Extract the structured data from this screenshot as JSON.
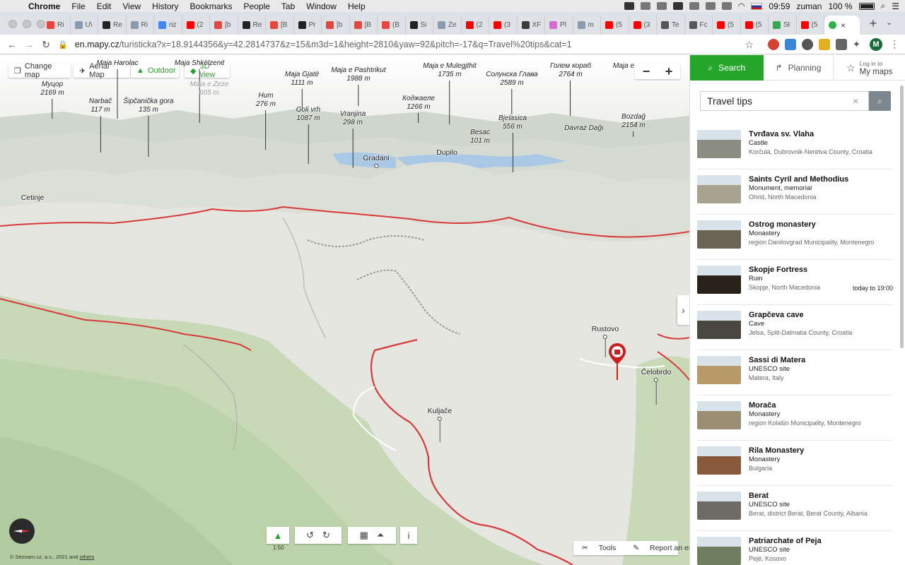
{
  "mac_menu": {
    "app": "Chrome",
    "items": [
      "File",
      "Edit",
      "View",
      "History",
      "Bookmarks",
      "People",
      "Tab",
      "Window",
      "Help"
    ],
    "time": "09:59",
    "user": "zuman",
    "battery": "100 %"
  },
  "browser": {
    "tabs": [
      {
        "label": "Ri",
        "color": "#e8453c"
      },
      {
        "label": "U\\",
        "color": "#8a9bb0"
      },
      {
        "label": "Re",
        "color": "#222222"
      },
      {
        "label": "Ri",
        "color": "#8a9bb0"
      },
      {
        "label": "riz",
        "color": "#4285f4"
      },
      {
        "label": "(2",
        "color": "#ff0000"
      },
      {
        "label": "[b",
        "color": "#e8453c"
      },
      {
        "label": "Re",
        "color": "#222222"
      },
      {
        "label": "[B",
        "color": "#e8453c"
      },
      {
        "label": "Pr",
        "color": "#222222"
      },
      {
        "label": "[b",
        "color": "#e8453c"
      },
      {
        "label": "[B",
        "color": "#e8453c"
      },
      {
        "label": "(B",
        "color": "#e8453c"
      },
      {
        "label": "Si",
        "color": "#222222"
      },
      {
        "label": "Ze",
        "color": "#8a9bb0"
      },
      {
        "label": "(2",
        "color": "#ff0000"
      },
      {
        "label": "(3",
        "color": "#ff0000"
      },
      {
        "label": "XF",
        "color": "#3a3a3a"
      },
      {
        "label": "Pl",
        "color": "#d86ad8"
      },
      {
        "label": "m",
        "color": "#8a9bb0"
      },
      {
        "label": "(5",
        "color": "#ff0000"
      },
      {
        "label": "(3",
        "color": "#ff0000"
      },
      {
        "label": "Te",
        "color": "#555555"
      },
      {
        "label": "Fc",
        "color": "#555555"
      },
      {
        "label": "(5",
        "color": "#ff0000"
      },
      {
        "label": "(5",
        "color": "#ff0000"
      },
      {
        "label": "Sł",
        "color": "#34a853"
      },
      {
        "label": "(5",
        "color": "#ff0000"
      }
    ],
    "url_host": "en.mapy.cz",
    "url_path": "/turisticka?x=18.9144356&y=42.2814737&z=15&m3d=1&height=2810&yaw=92&pitch=-17&q=Travel%20tips&cat=1",
    "profile_initial": "M"
  },
  "map": {
    "buttons": {
      "change_map": "Change map",
      "aerial_map": "Aerial Map",
      "outdoor": "Outdoor",
      "view3d": "3D view"
    },
    "zoom_out": "−",
    "zoom_in": "+",
    "peaks": [
      {
        "name": "Муцор",
        "elev": "2169 m"
      },
      {
        "name": "Maja Harolac",
        "elev": ""
      },
      {
        "name": "Narbač",
        "elev": "117 m"
      },
      {
        "name": "Šipčanička gora",
        "elev": "135 m"
      },
      {
        "name": "Maja Shkëlzenit",
        "elev": ""
      },
      {
        "name": "Maja e Zeze",
        "elev": "605 m"
      },
      {
        "name": "Hum",
        "elev": "276 m"
      },
      {
        "name": "Maja Gjatë",
        "elev": "1111 m"
      },
      {
        "name": "Goli vrh",
        "elev": "1087 m"
      },
      {
        "name": "Maja e Pashtrikut",
        "elev": "1988 m"
      },
      {
        "name": "Vranjina",
        "elev": "298 m"
      },
      {
        "name": "Коджаеле",
        "elev": "1266 m"
      },
      {
        "name": "Maja e Mulegjthit",
        "elev": "1735 m"
      },
      {
        "name": "Besac",
        "elev": "101 m"
      },
      {
        "name": "Солунска Глава",
        "elev": "2589 m"
      },
      {
        "name": "Bjelasica",
        "elev": "556 m"
      },
      {
        "name": "Голем кораб",
        "elev": "2764 m"
      },
      {
        "name": "Davraz Dağı",
        "elev": ""
      },
      {
        "name": "Maja e",
        "elev": ""
      },
      {
        "name": "Bozdağ",
        "elev": "2154 m"
      }
    ],
    "places": [
      {
        "name": "Gradani"
      },
      {
        "name": "Dupilo"
      },
      {
        "name": "Cetinje"
      },
      {
        "name": "Rustovo"
      },
      {
        "name": "Čelobrdo"
      },
      {
        "name": "Kuljače"
      }
    ],
    "scale": "1:50",
    "copyright_prefix": "© Seznam.cz, a.s., 2021 and",
    "copyright_link": "others",
    "tools": "Tools",
    "report": "Report an error"
  },
  "panel": {
    "tabs": {
      "search": "Search",
      "planning": "Planning",
      "login_small": "Log in to",
      "login_big": "My maps"
    },
    "query": "Travel tips",
    "results": [
      {
        "title": "Tvrđava sv. Vlaha",
        "type": "Castle",
        "location": "Korčula, Dubrovnik-Neretva County, Croatia",
        "hours": "",
        "thumb": "#8c8e84"
      },
      {
        "title": "Saints Cyril and Methodius",
        "type": "Monument, memorial",
        "location": "Ohrid, North Macedonia",
        "hours": "",
        "thumb": "#a7a38f"
      },
      {
        "title": "Ostrog monastery",
        "type": "Monastery",
        "location": "region Danilovgrad Municipality, Montenegro",
        "hours": "",
        "thumb": "#6b6456"
      },
      {
        "title": "Skopje Fortress",
        "type": "Ruin",
        "location": "Skopje, North Macedonia",
        "hours": "today to 19:00",
        "thumb": "#2a2218"
      },
      {
        "title": "Grapčeva cave",
        "type": "Cave",
        "location": "Jelsa, Split-Dalmatia County, Croatia",
        "hours": "",
        "thumb": "#4a4640"
      },
      {
        "title": "Sassi di Matera",
        "type": "UNESCO site",
        "location": "Matera, Italy",
        "hours": "",
        "thumb": "#b99a6b"
      },
      {
        "title": "Morača",
        "type": "Monastery",
        "location": "region Kolašin Municipality, Montenegro",
        "hours": "",
        "thumb": "#9a8f74"
      },
      {
        "title": "Rila Monastery",
        "type": "Monastery",
        "location": "Bulgaria",
        "hours": "",
        "thumb": "#8a5a3c"
      },
      {
        "title": "Berat",
        "type": "UNESCO site",
        "location": "Berat, district Berat, Berat County, Albania",
        "hours": "",
        "thumb": "#6e6a64"
      },
      {
        "title": "Patriarchate of Peja",
        "type": "UNESCO site",
        "location": "Pejë, Kosovo",
        "hours": "",
        "thumb": "#6f7e5e"
      }
    ]
  }
}
